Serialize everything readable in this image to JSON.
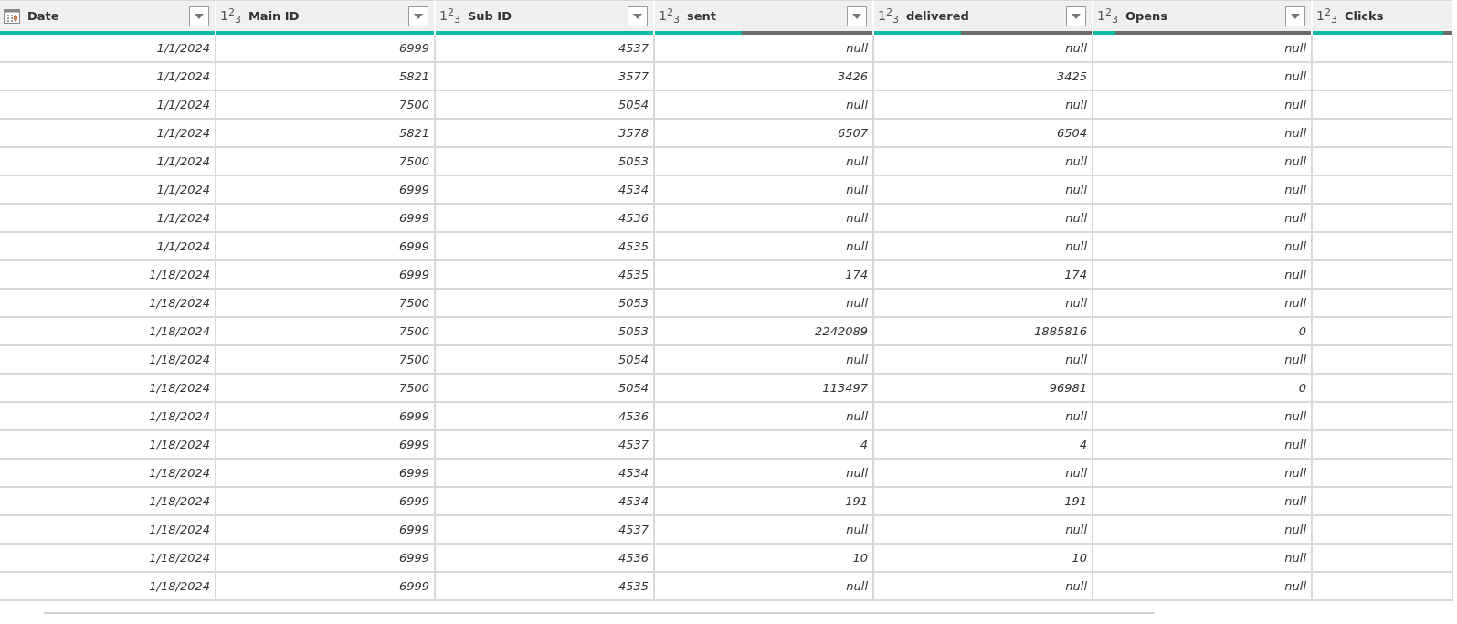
{
  "table": {
    "columns": [
      {
        "name": "Date",
        "kind": "date",
        "has_filter": true,
        "level": 1
      },
      {
        "name": "Main ID",
        "kind": "number",
        "glyph": "1$^{2}$$_{3}$",
        "has_filter": true,
        "level": 1
      },
      {
        "name": "Sub ID",
        "kind": "number",
        "glyph": "1$^{2}$$_{3}$",
        "has_filter": true,
        "level": 1
      },
      {
        "name": "sent",
        "kind": "number",
        "glyph": "1$^{2}$$_{3}$",
        "has_filter": true,
        "level": 0.4
      },
      {
        "name": "delivered",
        "kind": "number",
        "glyph": "1$^{2}$$_{3}$",
        "has_filter": true,
        "level": 0.4
      },
      {
        "name": "Opens",
        "kind": "number",
        "glyph": "1$^{2}$$_{3}$",
        "has_filter": true,
        "level": 0.1
      },
      {
        "name": "Clicks",
        "kind": "number",
        "glyph": "1$^{2}$$_{3}$",
        "has_filter": false,
        "level": 0.94
      }
    ],
    "rows": [
      [
        "1/1/2024",
        "6999",
        "4537",
        "null",
        "null",
        "null"
      ],
      [
        "1/1/2024",
        "5821",
        "3577",
        "3426",
        "3425",
        "null"
      ],
      [
        "1/1/2024",
        "7500",
        "5054",
        "null",
        "null",
        "null"
      ],
      [
        "1/1/2024",
        "5821",
        "3578",
        "6507",
        "6504",
        "null"
      ],
      [
        "1/1/2024",
        "7500",
        "5053",
        "null",
        "null",
        "null"
      ],
      [
        "1/1/2024",
        "6999",
        "4534",
        "null",
        "null",
        "null"
      ],
      [
        "1/1/2024",
        "6999",
        "4536",
        "null",
        "null",
        "null"
      ],
      [
        "1/1/2024",
        "6999",
        "4535",
        "null",
        "null",
        "null"
      ],
      [
        "1/18/2024",
        "6999",
        "4535",
        "174",
        "174",
        "null"
      ],
      [
        "1/18/2024",
        "7500",
        "5053",
        "null",
        "null",
        "null"
      ],
      [
        "1/18/2024",
        "7500",
        "5053",
        "2242089",
        "1885816",
        "0"
      ],
      [
        "1/18/2024",
        "7500",
        "5054",
        "null",
        "null",
        "null"
      ],
      [
        "1/18/2024",
        "7500",
        "5054",
        "113497",
        "96981",
        "0"
      ],
      [
        "1/18/2024",
        "6999",
        "4536",
        "null",
        "null",
        "null"
      ],
      [
        "1/18/2024",
        "6999",
        "4537",
        "4",
        "4",
        "null"
      ],
      [
        "1/18/2024",
        "6999",
        "4534",
        "null",
        "null",
        "null"
      ],
      [
        "1/18/2024",
        "6999",
        "4534",
        "191",
        "191",
        "null"
      ],
      [
        "1/18/2024",
        "6999",
        "4537",
        "null",
        "null",
        "null"
      ],
      [
        "1/18/2024",
        "6999",
        "4536",
        "10",
        "10",
        "null"
      ],
      [
        "1/18/2024",
        "6999",
        "4535",
        "null",
        "null",
        "null"
      ]
    ]
  }
}
